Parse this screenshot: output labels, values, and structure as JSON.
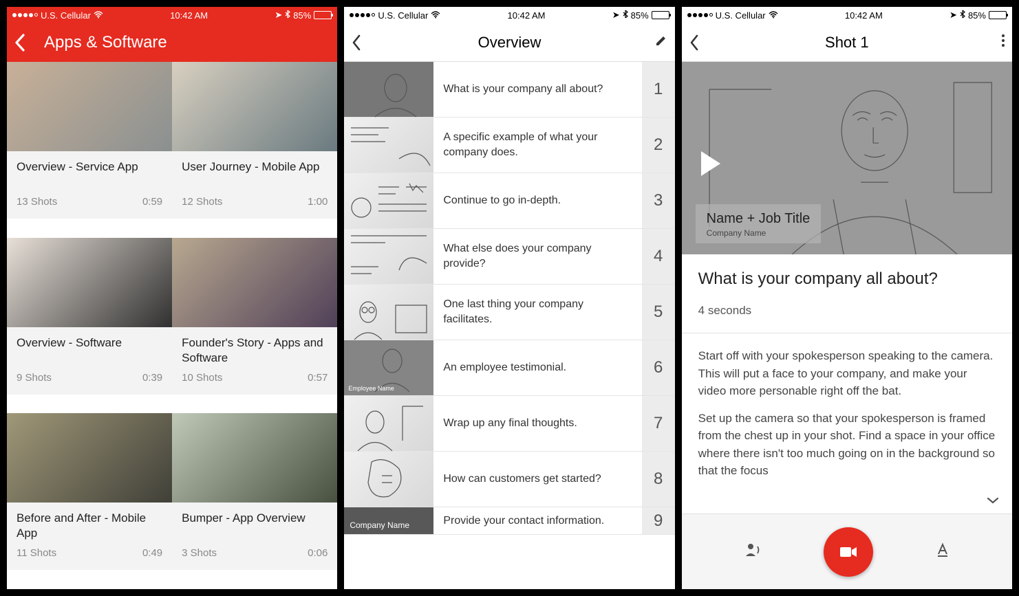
{
  "status": {
    "carrier": "U.S. Cellular",
    "time": "10:42 AM",
    "battery_pct": "85%"
  },
  "screen1": {
    "nav_title": "Apps & Software",
    "cards": [
      {
        "title": "Overview - Service App",
        "shots": "13 Shots",
        "time": "0:59"
      },
      {
        "title": "User Journey - Mobile App",
        "shots": "12 Shots",
        "time": "1:00"
      },
      {
        "title": "Overview - Software",
        "shots": "9 Shots",
        "time": "0:39"
      },
      {
        "title": "Founder's Story - Apps and Software",
        "shots": "10 Shots",
        "time": "0:57"
      },
      {
        "title": "Before and After - Mobile App",
        "shots": "11 Shots",
        "time": "0:49"
      },
      {
        "title": "Bumper - App Overview",
        "shots": "3 Shots",
        "time": "0:06"
      }
    ]
  },
  "screen2": {
    "nav_title": "Overview",
    "shots": [
      {
        "n": "1",
        "text": "What is your company all about?"
      },
      {
        "n": "2",
        "text": "A specific example of what your company does."
      },
      {
        "n": "3",
        "text": "Continue to go in-depth."
      },
      {
        "n": "4",
        "text": "What else does your company provide?"
      },
      {
        "n": "5",
        "text": "One last thing your company facilitates."
      },
      {
        "n": "6",
        "text": "An employee testimonial."
      },
      {
        "n": "7",
        "text": "Wrap up any final thoughts."
      },
      {
        "n": "8",
        "text": "How can customers get started?"
      },
      {
        "n": "9",
        "text": "Provide your contact information."
      }
    ],
    "thumb6_label": "Employee Name",
    "last_thumb_label": "Company Name"
  },
  "screen3": {
    "nav_title": "Shot 1",
    "caption_title": "Name + Job Title",
    "caption_sub": "Company Name",
    "question": "What is your company all about?",
    "duration": "4 seconds",
    "para1": "Start off with your spokesperson speaking to the camera. This will put a face to your company, and make your video more personable right off the bat.",
    "para2": "Set up the camera so that your spokesperson is framed from the chest up in your shot. Find a space in your office where there isn't too much going on in the background so that the focus"
  }
}
